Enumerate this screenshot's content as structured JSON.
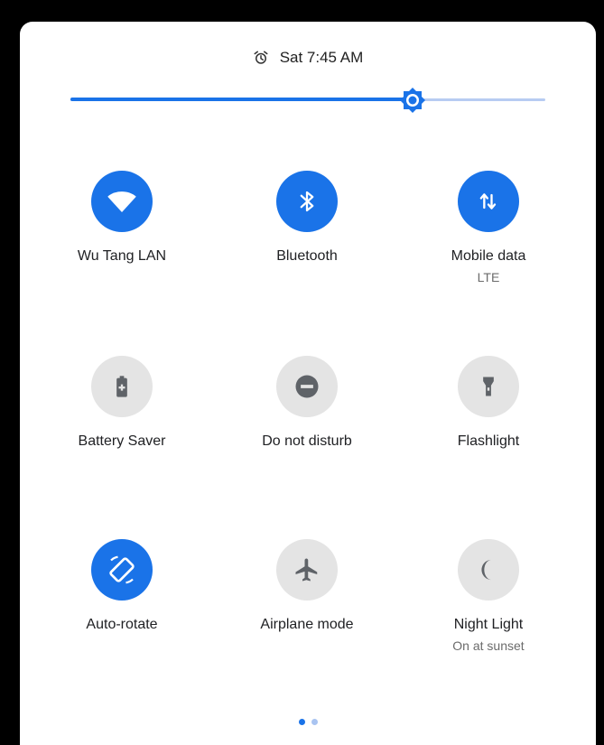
{
  "status": {
    "time": "Sat 7:45 AM",
    "alarm_icon": "alarm-clock-icon"
  },
  "brightness": {
    "level": 0.72,
    "icon": "brightness-sun-icon",
    "accent": "#1a73e8"
  },
  "tiles": [
    {
      "label": "Wu Tang LAN",
      "sublabel": "",
      "icon": "wifi-icon",
      "active": true
    },
    {
      "label": "Bluetooth",
      "sublabel": "",
      "icon": "bluetooth-icon",
      "active": true
    },
    {
      "label": "Mobile data",
      "sublabel": "LTE",
      "icon": "mobile-data-icon",
      "active": true
    },
    {
      "label": "Battery Saver",
      "sublabel": "",
      "icon": "battery-saver-icon",
      "active": false
    },
    {
      "label": "Do not disturb",
      "sublabel": "",
      "icon": "do-not-disturb-icon",
      "active": false
    },
    {
      "label": "Flashlight",
      "sublabel": "",
      "icon": "flashlight-icon",
      "active": false
    },
    {
      "label": "Auto-rotate",
      "sublabel": "",
      "icon": "auto-rotate-icon",
      "active": true
    },
    {
      "label": "Airplane mode",
      "sublabel": "",
      "icon": "airplane-icon",
      "active": false
    },
    {
      "label": "Night Light",
      "sublabel": "On at sunset",
      "icon": "night-light-moon-icon",
      "active": false
    }
  ],
  "pager": {
    "pages": 2,
    "current": 1
  },
  "colors": {
    "active_tile": "#1a73e8",
    "inactive_tile": "#e4e4e4",
    "inactive_glyph": "#5f6368"
  }
}
